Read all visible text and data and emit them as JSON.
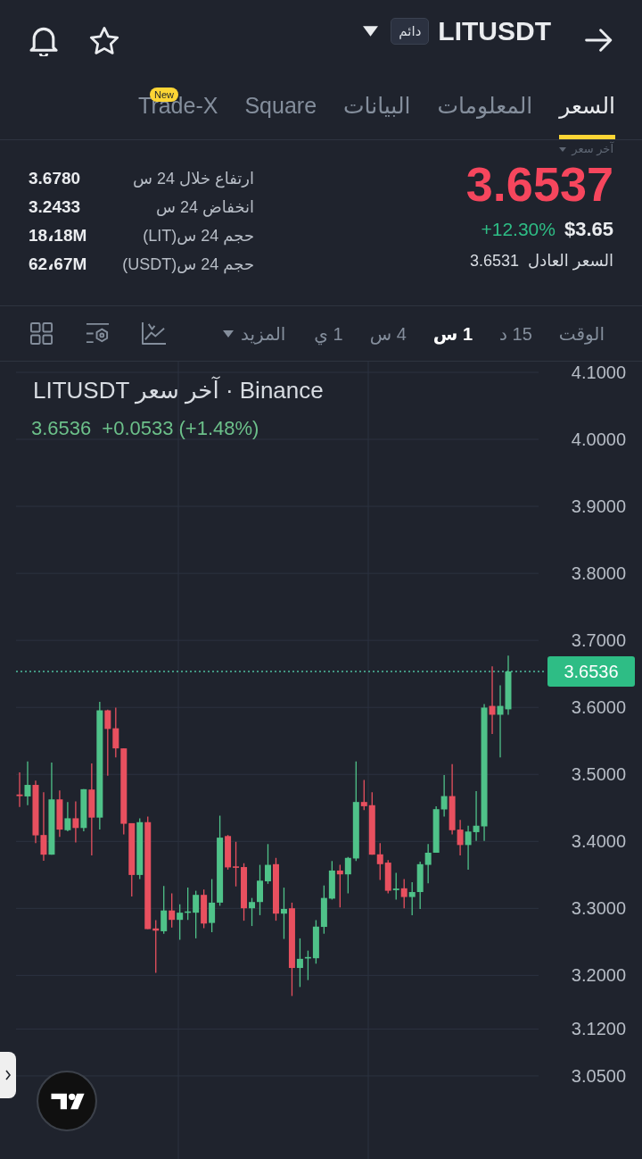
{
  "header": {
    "symbol": "LITUSDT",
    "contract_tag": "دائم"
  },
  "tabs": [
    {
      "label": "السعر",
      "selected": true
    },
    {
      "label": "المعلومات",
      "selected": false
    },
    {
      "label": "البيانات",
      "selected": false
    },
    {
      "label": "Square",
      "selected": false
    },
    {
      "label": "Trade-X",
      "selected": false,
      "badge": "New"
    }
  ],
  "price": {
    "selector_label": "آخر سعر",
    "last": "3.6537",
    "usd_price": "$3.65",
    "change": "+12.30%",
    "fair_price_label": "السعر العادل",
    "fair_price": "3.6531"
  },
  "stats": [
    {
      "label": "ارتفاع خلال 24 س",
      "value": "3.6780"
    },
    {
      "label": "انخفاض 24 س",
      "value": "3.2433"
    },
    {
      "label": "حجم 24 س(LIT)",
      "value": "18،18M"
    },
    {
      "label": "حجم 24 س(USDT)",
      "value": "62،67M"
    }
  ],
  "toolbar": {
    "label": "الوقت",
    "intervals": [
      {
        "label": "15 د",
        "selected": false
      },
      {
        "label": "1 س",
        "selected": true
      },
      {
        "label": "4 س",
        "selected": false
      },
      {
        "label": "1 ي",
        "selected": false
      }
    ],
    "more": "المزيد"
  },
  "chart": {
    "legend_price": "3.6536",
    "legend_change": "+0.0533 (+1.48%)",
    "chart_data": {
      "type": "candlestick",
      "title": "LITUSDT آخر سعر · Binance",
      "categories": [
        null,
        null,
        null,
        null,
        null,
        null,
        null,
        null,
        null,
        null,
        null,
        null,
        null,
        null,
        null,
        null,
        null,
        null,
        null,
        null,
        null,
        null,
        null,
        null,
        null,
        null,
        null,
        null,
        null,
        null,
        null,
        null,
        null,
        null,
        null,
        null,
        null,
        null,
        null,
        null,
        null,
        null,
        null,
        null,
        null,
        null,
        null,
        null,
        null,
        null,
        null,
        null,
        null,
        null,
        null,
        null,
        null,
        null,
        null,
        null,
        null,
        null
      ],
      "ohlc": [
        [
          3.47,
          3.503,
          3.4515,
          3.4676
        ],
        [
          3.4671,
          3.5193,
          3.454,
          3.4843
        ],
        [
          3.4843,
          3.4907,
          3.3975,
          3.409
        ],
        [
          3.4095,
          3.4735,
          3.3712,
          3.3802
        ],
        [
          3.3802,
          3.5178,
          3.3802,
          3.4627
        ],
        [
          3.4627,
          3.4759,
          3.4066,
          3.4176
        ],
        [
          3.4167,
          3.4588,
          3.4152,
          3.4345
        ],
        [
          3.4345,
          3.4598,
          3.3984,
          3.42
        ],
        [
          3.42,
          3.4779,
          3.4152,
          3.4779
        ],
        [
          3.4774,
          3.5164,
          3.3792,
          3.4355
        ],
        [
          3.4355,
          3.6083,
          3.4176,
          3.5956
        ],
        [
          3.5956,
          3.5966,
          3.4981,
          3.5678
        ],
        [
          3.5688,
          3.5997,
          3.5252,
          3.5388
        ],
        [
          3.5388,
          3.5388,
          3.4104,
          3.4263
        ],
        [
          3.4272,
          3.4272,
          3.3179,
          3.3499
        ],
        [
          3.3499,
          3.4345,
          3.3437,
          3.4287
        ],
        [
          3.4287,
          3.4369,
          3.2691,
          3.2691
        ],
        [
          3.2701,
          3.2825,
          3.2039,
          3.2668
        ],
        [
          3.2659,
          3.3333,
          3.2622,
          3.2969
        ],
        [
          3.2969,
          3.3226,
          3.2714,
          3.2829
        ],
        [
          3.2829,
          3.3062,
          3.253,
          3.2936
        ],
        [
          3.2936,
          3.331,
          3.2829,
          3.2955
        ],
        [
          3.2936,
          3.3263,
          3.2553,
          3.3202
        ],
        [
          3.3202,
          3.3282,
          3.2705,
          3.2774
        ],
        [
          3.2783,
          3.3437,
          3.2645,
          3.3086
        ],
        [
          3.3086,
          3.4384,
          3.3039,
          3.4056
        ],
        [
          3.408,
          3.4095,
          3.3579,
          3.3612
        ],
        [
          3.3627,
          3.3994,
          3.3328,
          3.3612
        ],
        [
          3.3617,
          3.3674,
          3.2816,
          3.3002
        ],
        [
          3.3002,
          3.3156,
          3.2737,
          3.3095
        ],
        [
          3.3095,
          3.365,
          3.2899,
          3.3414
        ],
        [
          3.3404,
          3.396,
          3.3366,
          3.365
        ],
        [
          3.366,
          3.3754,
          3.2816,
          3.2922
        ],
        [
          3.2922,
          3.331,
          3.2544,
          3.2992
        ],
        [
          3.3002,
          3.3086,
          3.1693,
          3.2111
        ],
        [
          3.2111,
          3.2553,
          3.1827,
          3.2247
        ],
        [
          3.2256,
          3.237,
          3.193,
          3.2274
        ],
        [
          3.2256,
          3.2825,
          3.2175,
          3.2728
        ],
        [
          3.2724,
          3.3342,
          3.2622,
          3.3156
        ],
        [
          3.3146,
          3.3707,
          3.3132,
          3.3565
        ],
        [
          3.3565,
          3.365,
          3.3016,
          3.3508
        ],
        [
          3.3508,
          3.3769,
          3.3226,
          3.3754
        ],
        [
          3.3745,
          3.5193,
          3.3707,
          3.4588
        ],
        [
          3.4588,
          3.4917,
          3.4467,
          3.4525
        ],
        [
          3.454,
          3.4735,
          3.3802,
          3.3802
        ],
        [
          3.3807,
          3.3975,
          3.3423,
          3.366
        ],
        [
          3.3683,
          3.3721,
          3.3226,
          3.3263
        ],
        [
          3.3272,
          3.3532,
          3.3132,
          3.3296
        ],
        [
          3.33,
          3.3437,
          3.3002,
          3.317
        ],
        [
          3.317,
          3.339,
          3.2899,
          3.3244
        ],
        [
          3.3244,
          3.3698,
          3.2992,
          3.366
        ],
        [
          3.365,
          3.396,
          3.3376,
          3.3831
        ],
        [
          3.3831,
          3.4525,
          3.3831,
          3.4481
        ],
        [
          3.4477,
          3.4991,
          3.4369,
          3.4676
        ],
        [
          3.4676,
          3.5154,
          3.4104,
          3.4167
        ],
        [
          3.4176,
          3.4321,
          3.3792,
          3.3946
        ],
        [
          3.3946,
          3.4234,
          3.3579,
          3.4147
        ],
        [
          3.4138,
          3.4749,
          3.4008,
          3.4234
        ],
        [
          3.4224,
          3.6048,
          3.4008,
          3.5997
        ],
        [
          3.6022,
          3.6611,
          3.5603,
          3.589
        ],
        [
          3.589,
          3.6328,
          3.5252,
          3.6022
        ],
        [
          3.5971,
          3.6771,
          3.589,
          3.6536
        ]
      ],
      "ylim": [
        2.926,
        4.116
      ],
      "grid": true,
      "ref_lines": [
        {
          "axis": "y",
          "value": 3.6536,
          "label": "3.6536"
        }
      ],
      "yticks": [
        {
          "value": 4.1,
          "label": "4.1000"
        },
        {
          "value": 4.0,
          "label": "4.0000"
        },
        {
          "value": 3.9,
          "label": "3.9000"
        },
        {
          "value": 3.8,
          "label": "3.8000"
        },
        {
          "value": 3.7,
          "label": "3.7000"
        },
        {
          "value": 3.6,
          "label": "3.6000"
        },
        {
          "value": 3.5,
          "label": "3.5000"
        },
        {
          "value": 3.4,
          "label": "3.4000"
        },
        {
          "value": 3.3,
          "label": "3.3000"
        },
        {
          "value": 3.2,
          "label": "3.2000"
        },
        {
          "value": 3.12,
          "label": "3.1200"
        },
        {
          "value": 3.05,
          "label": "3.0500"
        }
      ]
    }
  }
}
